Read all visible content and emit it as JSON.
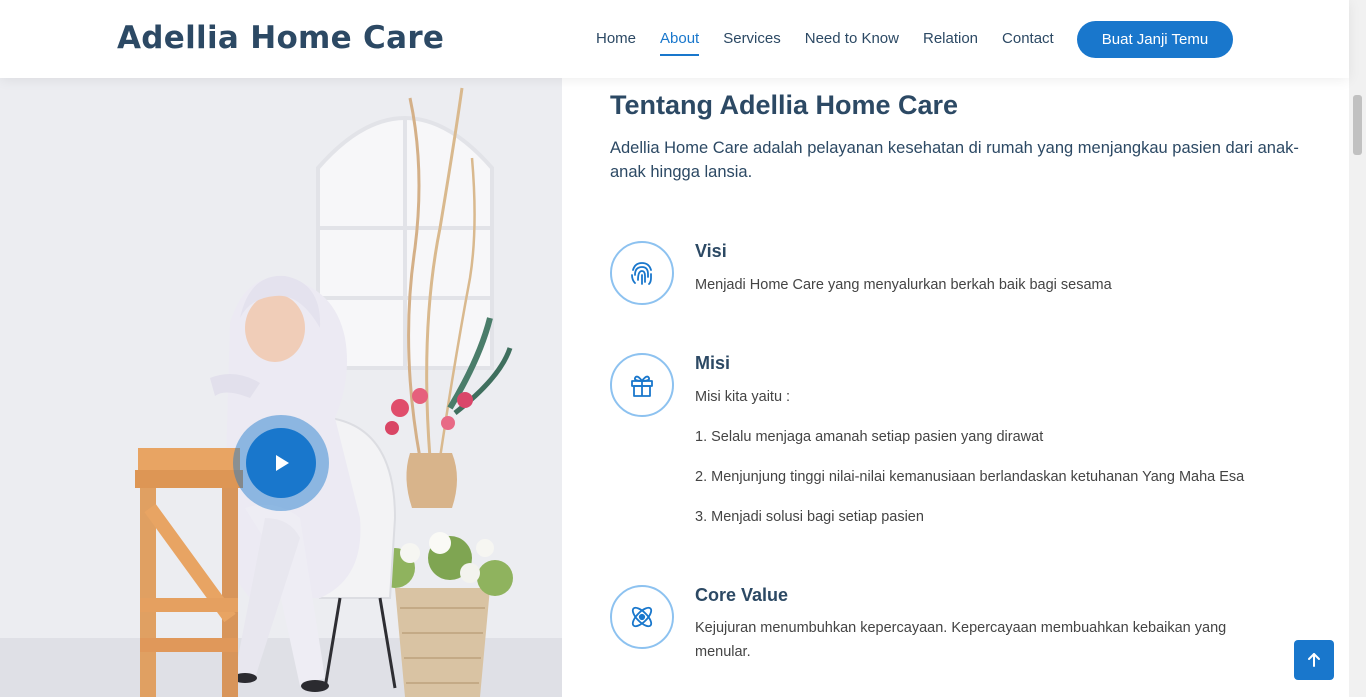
{
  "header": {
    "logo": "Adellia Home Care",
    "nav": [
      "Home",
      "About",
      "Services",
      "Need to Know",
      "Relation",
      "Contact"
    ],
    "active_nav": "About",
    "cta": "Buat Janji Temu"
  },
  "about": {
    "title": "Tentang Adellia Home Care",
    "description": "Adellia Home Care adalah pelayanan kesehatan di rumah yang menjangkau pasien dari anak-anak hingga lansia.",
    "visi": {
      "icon": "fingerprint-icon",
      "title": "Visi",
      "text": "Menjadi Home Care yang menyalurkan berkah baik bagi sesama"
    },
    "misi": {
      "icon": "gift-icon",
      "title": "Misi",
      "intro": "Misi kita yaitu :",
      "items": [
        "1. Selalu menjaga amanah setiap pasien yang dirawat",
        "2. Menjunjung tinggi nilai-nilai kemanusiaan berlandaskan ketuhanan Yang Maha Esa",
        "3. Menjadi solusi bagi setiap pasien"
      ]
    },
    "core_value": {
      "icon": "atom-icon",
      "title": "Core Value",
      "text": "Kejujuran menumbuhkan kepercayaan. Kepercayaan membuahkan kebaikan yang menular."
    }
  },
  "colors": {
    "accent": "#1977cc",
    "heading": "#2c4964",
    "icon_border": "#8dc2f0"
  }
}
